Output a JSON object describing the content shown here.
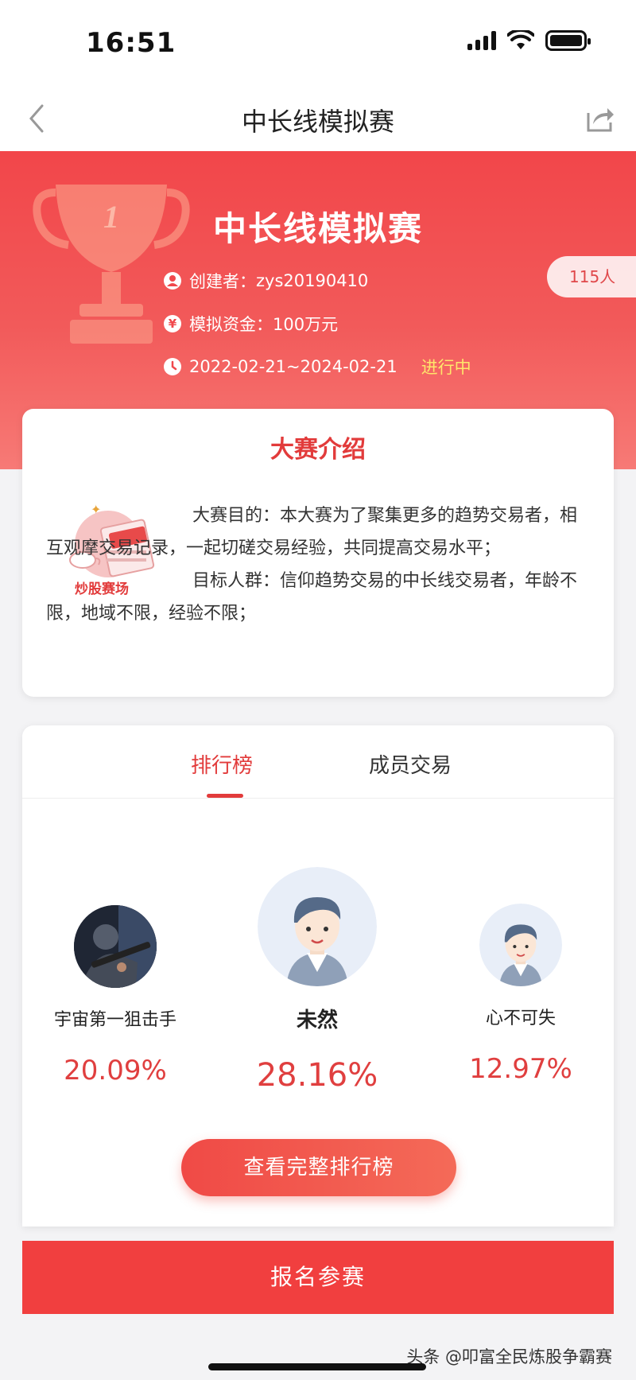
{
  "status_bar": {
    "time": "16:51"
  },
  "nav": {
    "title": "中长线模拟赛",
    "back_icon": "chevron-left-icon",
    "share_icon": "share-icon"
  },
  "hero": {
    "title": "中长线模拟赛",
    "creator_label": "创建者：",
    "creator": "zys20190410",
    "fund_label": "模拟资金：",
    "fund": "100万元",
    "date_range": "2022-02-21~2024-02-21",
    "status": "进行中",
    "participants": "115人"
  },
  "intro": {
    "title": "大赛介绍",
    "logo_label": "炒股赛场",
    "purpose": "大赛目的：本大赛为了聚集更多的趋势交易者，相互观摩交易记录，一起切磋交易经验，共同提高交易水平；",
    "audience": "目标人群：信仰趋势交易的中长线交易者，年龄不限，地域不限，经验不限；"
  },
  "ranking": {
    "tabs": [
      {
        "label": "排行榜",
        "active": true
      },
      {
        "label": "成员交易",
        "active": false
      }
    ],
    "top3": [
      {
        "name": "宇宙第一狙击手",
        "pct": "20.09%"
      },
      {
        "name": "未然",
        "pct": "28.16%"
      },
      {
        "name": "心不可失",
        "pct": "12.97%"
      }
    ],
    "full_button": "查看完整排行榜"
  },
  "signup_button": "报名参赛",
  "watermark": "头条 @叩富全民炼股争霸赛",
  "colors": {
    "primary": "#f13f3f",
    "highlight": "#ffe66b"
  }
}
